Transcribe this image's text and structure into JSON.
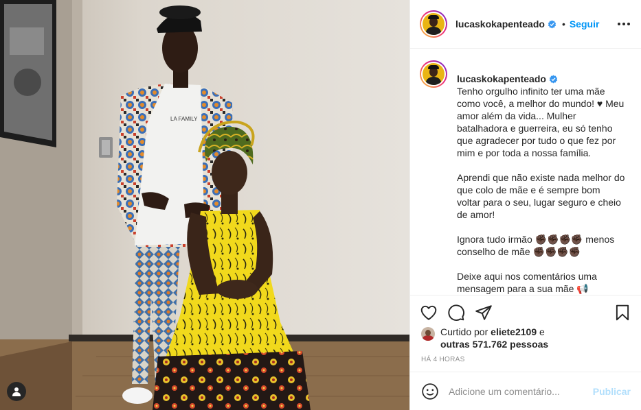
{
  "post": {
    "username": "lucaskokapenteado",
    "follow_separator": "•",
    "follow_label": "Seguir",
    "verified": true,
    "more_icon": "more-options-icon",
    "tag_icon": "user-tag-icon"
  },
  "caption": {
    "username": "lucaskokapenteado",
    "paragraphs": [
      "Tenho orgulho infinito ter uma mãe como você, a melhor do mundo! ♥ Meu amor além da vida... Mulher batalhadora e guerreira, eu só tenho que agradecer por tudo o que fez por mim e por toda a nossa família.",
      "Aprendi que não existe nada melhor do que colo de mãe e é sempre bom voltar para o seu, lugar seguro e cheio de amor!",
      "Ignora tudo irmão ✊🏿✊🏿✊🏿✊🏿 menos conselho de mãe ✊🏿✊🏿✊🏿✊🏿",
      "Deixe aqui nos comentários uma mensagem para a sua mãe 📢"
    ]
  },
  "actions": {
    "like_icon": "heart-icon",
    "comment_icon": "comment-icon",
    "share_icon": "share-icon",
    "save_icon": "bookmark-icon"
  },
  "likes": {
    "prefix": "Curtido por",
    "liker": "eliete2109",
    "joiner": "e",
    "others": "outras 571.762 pessoas"
  },
  "timestamp": "HÁ 4 HORAS",
  "comment": {
    "emoji_icon": "emoji-icon",
    "placeholder": "Adicione um comentário...",
    "post_label": "Publicar"
  },
  "colors": {
    "accent_blue": "#0095f6",
    "publish_disabled": "#b2dffc",
    "text": "#262626",
    "muted": "#8e8e8e",
    "border": "#efefef"
  }
}
